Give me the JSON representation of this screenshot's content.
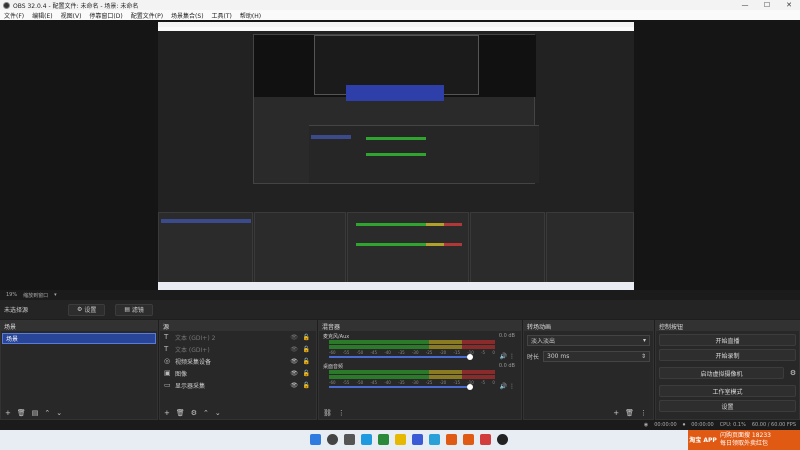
{
  "window": {
    "title": "OBS 32.0.4 - 配置文件: 未命名 - 场景: 未命名",
    "controls": [
      "—",
      "☐",
      "✕"
    ]
  },
  "menu": [
    "文件(F)",
    "编辑(E)",
    "视图(V)",
    "停靠窗口(D)",
    "配置文件(P)",
    "场景集合(S)",
    "工具(T)",
    "帮助(H)"
  ],
  "toolbar": {
    "zoom": "19%",
    "zoom_mode": "缩放到窗口"
  },
  "scenebar": {
    "label": "未选择源",
    "properties": "设置",
    "filters": "滤镜"
  },
  "docks": {
    "scenes": {
      "title": "场景",
      "items": [
        "场景"
      ]
    },
    "sources": {
      "title": "源",
      "items": [
        {
          "icon": "text-icon",
          "glyph": "T",
          "label": "文本 (GDI+) 2",
          "dim": true
        },
        {
          "icon": "text-icon",
          "glyph": "T",
          "label": "文本 (GDI+)",
          "dim": true
        },
        {
          "icon": "camera-icon",
          "glyph": "◎",
          "label": "视频采集设备",
          "dim": false
        },
        {
          "icon": "image-icon",
          "glyph": "▣",
          "label": "图像",
          "dim": false
        },
        {
          "icon": "monitor-icon",
          "glyph": "▭",
          "label": "显示器采集",
          "dim": false
        }
      ]
    },
    "mixer": {
      "title": "混音器",
      "channels": [
        {
          "name": "麦克风/Aux",
          "db": "0.0 dB"
        },
        {
          "name": "桌面音频",
          "db": "0.0 dB"
        }
      ],
      "scale": [
        "-60",
        "-55",
        "-50",
        "-45",
        "-40",
        "-35",
        "-30",
        "-25",
        "-20",
        "-15",
        "-10",
        "-5",
        "0"
      ]
    },
    "transitions": {
      "title": "转场动画",
      "type": "淡入淡出",
      "duration_label": "时长",
      "duration": "300 ms"
    },
    "controls": {
      "title": "控制按钮",
      "buttons": [
        "开始直播",
        "开始录制",
        "启动虚拟摄像机",
        "工作室模式",
        "设置"
      ]
    }
  },
  "status": {
    "rec": "00:00:00",
    "live": "00:00:00",
    "cpu": "CPU: 0.1%",
    "fps": "60.00 / 60.00 FPS"
  },
  "ad": {
    "badge": "淘宝 APP",
    "line1": "闪购页面搜 18233",
    "line2": "每日领取外卖红包"
  },
  "colors": {
    "accent": "#284598",
    "meter_green": "#2a7a2a",
    "meter_yellow": "#8a7b22",
    "meter_red": "#8a2b2b"
  }
}
